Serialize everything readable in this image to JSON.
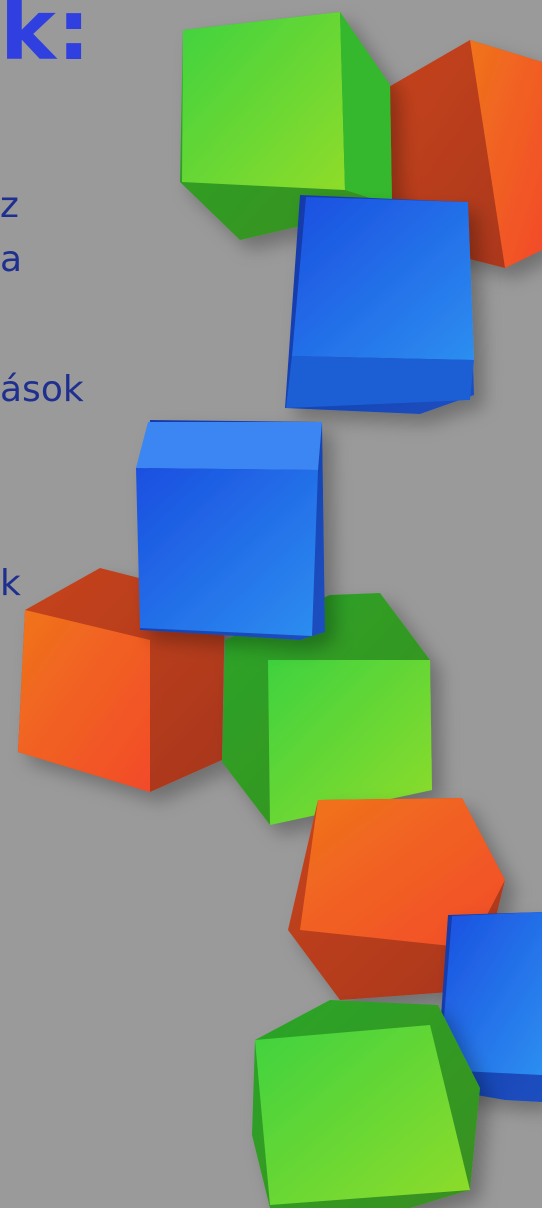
{
  "heading": "k:",
  "text_fragments": [
    "z",
    "a",
    "ások",
    "k"
  ],
  "colors": {
    "background": "#9a9a9a",
    "heading": "#2f3fe0",
    "body_text": "#1f2f8f",
    "cube_green": "#4fd838",
    "cube_orange": "#f06a2a",
    "cube_blue": "#2563e6"
  }
}
